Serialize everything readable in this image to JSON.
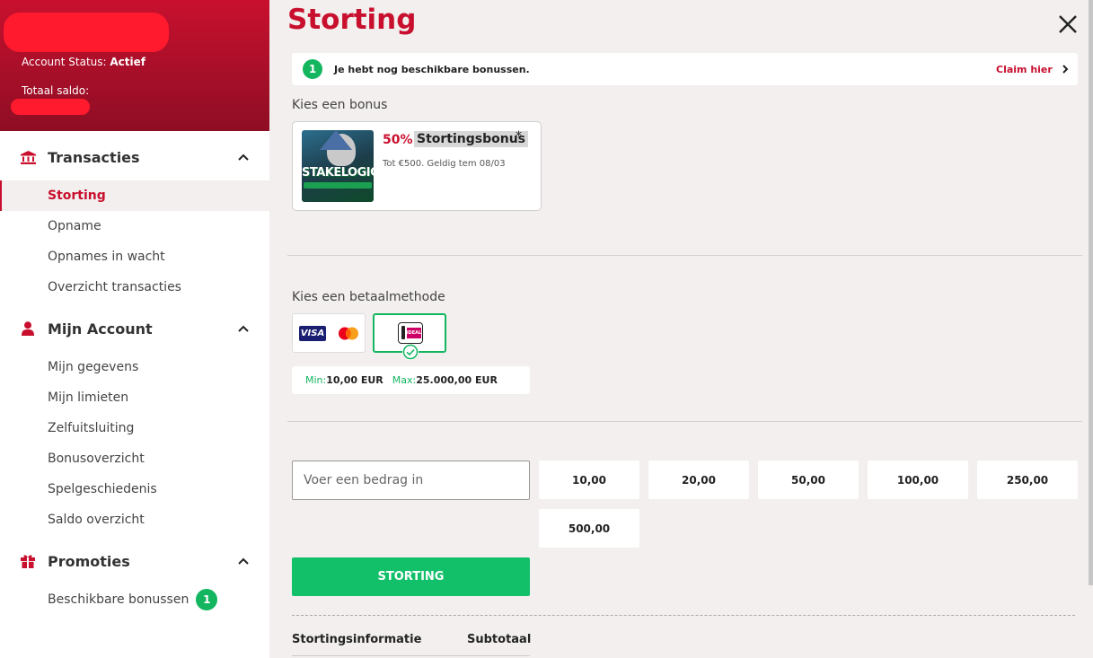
{
  "sidebar": {
    "account": {
      "status_label": "Account Status:",
      "status_value": "Actief",
      "balance_label": "Totaal saldo:"
    },
    "sections": [
      {
        "label": "Transacties",
        "icon": "bank-icon",
        "items": [
          "Storting",
          "Opname",
          "Opnames in wacht",
          "Overzicht transacties"
        ]
      },
      {
        "label": "Mijn Account",
        "icon": "user-icon",
        "items": [
          "Mijn gegevens",
          "Mijn limieten",
          "Zelfuitsluiting",
          "Bonusoverzicht",
          "Spelgeschiedenis",
          "Saldo overzicht"
        ]
      },
      {
        "label": "Promoties",
        "icon": "gift-icon",
        "items": [
          "Beschikbare bonussen"
        ],
        "badge": "1"
      }
    ],
    "active_item": "Storting"
  },
  "main": {
    "title": "Storting",
    "banner": {
      "count": "1",
      "message": "Je hebt nog beschikbare bonussen.",
      "claim": "Claim hier"
    },
    "bonus_label": "Kies een bonus",
    "bonus": {
      "image_text": "STAKELOGIC",
      "percent": "50%",
      "name": "Stortingsbonus",
      "star": "*",
      "detail": "Tot €500. Geldig tem 08/03"
    },
    "payment_label": "Kies een betaalmethode",
    "payment_methods": [
      {
        "name": "Visa / Mastercard",
        "visa_text": "VISA"
      },
      {
        "name": "iDEAL",
        "logo_text": "iDEAL",
        "selected": true
      }
    ],
    "limits": {
      "min_label": "Min:",
      "min_value": "10,00 EUR",
      "max_label": "Max:",
      "max_value": "25.000,00 EUR"
    },
    "amount_placeholder": "Voer een bedrag in",
    "amounts": [
      "10,00",
      "20,00",
      "50,00",
      "100,00",
      "250,00",
      "500,00"
    ],
    "deposit_button": "STORTING",
    "info": {
      "col1": "Stortingsinformatie",
      "col2": "Subtotaal"
    }
  },
  "colors": {
    "brand_red": "#c8102e",
    "success_green": "#13b65f",
    "background": "#f2efee"
  }
}
